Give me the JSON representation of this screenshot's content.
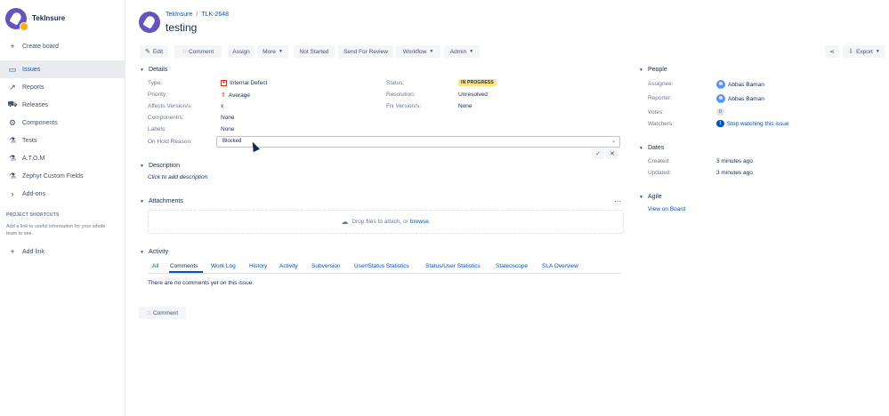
{
  "sidebar": {
    "project_name": "TekInsure",
    "items": [
      {
        "label": "Create board",
        "icon": "plus-icon"
      },
      {
        "label": "Issues",
        "icon": "issues-icon"
      },
      {
        "label": "Reports",
        "icon": "reports-icon"
      },
      {
        "label": "Releases",
        "icon": "releases-icon"
      },
      {
        "label": "Components",
        "icon": "components-icon"
      },
      {
        "label": "Tests",
        "icon": "tests-icon"
      },
      {
        "label": "A.T.O.M",
        "icon": "atom-icon"
      },
      {
        "label": "Zephyr Custom Fields",
        "icon": "zephyr-icon"
      },
      {
        "label": "Add-ons",
        "icon": "chevron-right-icon"
      }
    ],
    "shortcuts_title": "PROJECT SHORTCUTS",
    "shortcuts_text": "Add a link to useful information for your whole team to see.",
    "add_link": "Add link"
  },
  "header": {
    "breadcrumb_project": "TekInsure",
    "breadcrumb_sep": "/",
    "breadcrumb_issue": "TLK-2648",
    "title": "testing"
  },
  "toolbar": {
    "edit": "Edit",
    "comment": "Comment",
    "assign": "Assign",
    "more": "More",
    "not_started": "Not Started",
    "send_for_review": "Send For Review",
    "workflow": "Workflow",
    "admin": "Admin",
    "export": "Export"
  },
  "details": {
    "heading": "Details",
    "type_label": "Type:",
    "type_value": "Internal Defect",
    "priority_label": "Priority:",
    "priority_value": "Average",
    "affects_label": "Affects Version/s:",
    "affects_value": "x",
    "components_label": "Component/s:",
    "components_value": "None",
    "labels_label": "Labels:",
    "labels_value": "None",
    "onhold_label": "On Hold Reason:",
    "onhold_value": "Blocked",
    "status_label": "Status:",
    "status_value": "IN PROGRESS",
    "resolution_label": "Resolution:",
    "resolution_value": "Unresolved",
    "fix_label": "Fix Version/s:",
    "fix_value": "None"
  },
  "description": {
    "heading": "Description",
    "placeholder": "Click to add description"
  },
  "attachments": {
    "heading": "Attachments",
    "drop_text": "Drop files to attach, or",
    "browse": "browse."
  },
  "activity": {
    "heading": "Activity",
    "tabs": [
      "All",
      "Comments",
      "Work Log",
      "History",
      "Activity",
      "Subversion",
      "User/Status Statistics",
      "Status/User Statistics",
      "Stateoscope",
      "SLA Overview"
    ],
    "empty_text": "There are no comments yet on this issue.",
    "comment_button": "Comment"
  },
  "people": {
    "heading": "People",
    "assignee_label": "Assignee:",
    "assignee_value": "Abbas Baman",
    "reporter_label": "Reporter:",
    "reporter_value": "Abbas Baman",
    "votes_label": "Votes:",
    "votes_value": "0",
    "watchers_label": "Watchers:",
    "watchers_count": "1",
    "watchers_link": "Stop watching this issue"
  },
  "dates": {
    "heading": "Dates",
    "created_label": "Created:",
    "created_value": "3 minutes ago",
    "updated_label": "Updated:",
    "updated_value": "3 minutes ago"
  },
  "agile": {
    "heading": "Agile",
    "link": "View on Board"
  },
  "colors": {
    "accent": "#0052cc",
    "status_lozenge": "#ffe380",
    "project_avatar": "#6554c0"
  }
}
